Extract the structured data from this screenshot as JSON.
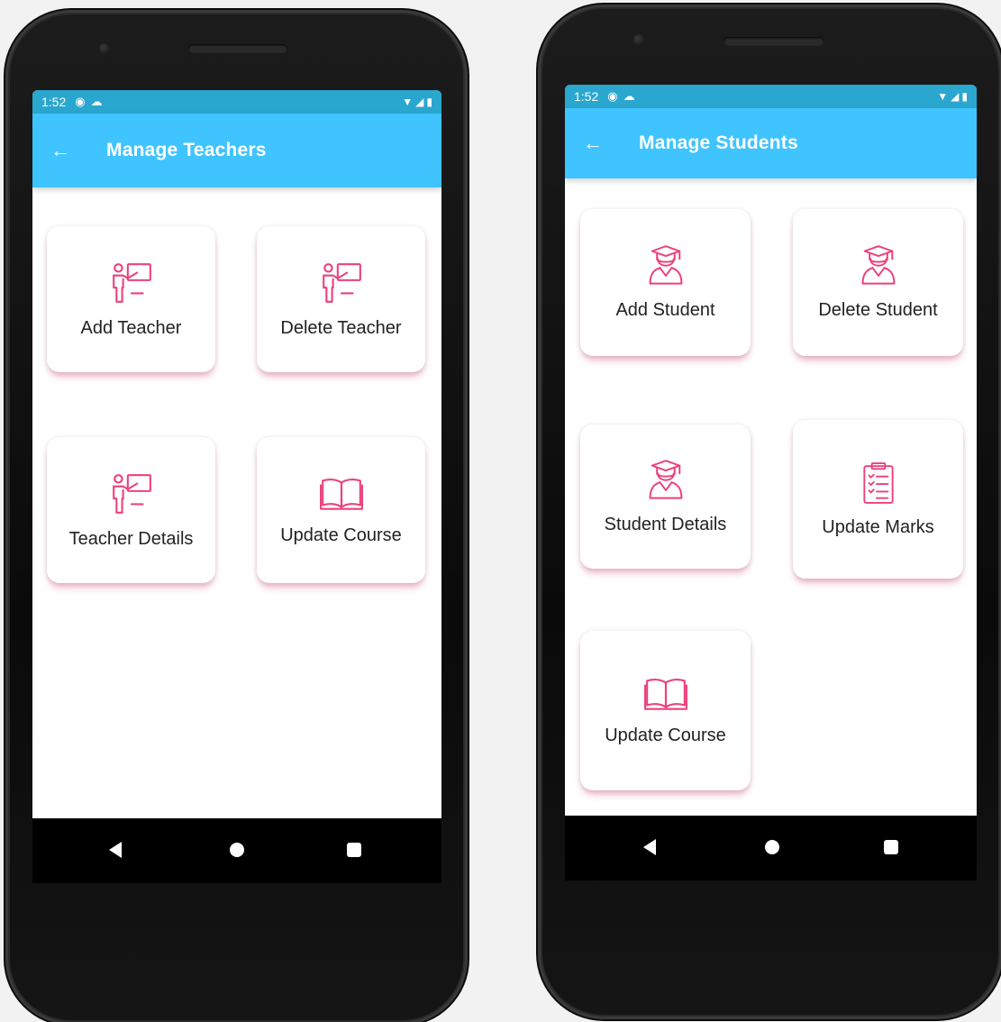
{
  "theme": {
    "statusbar_color": "#2aa7cf",
    "appbar_color": "#40c4ff",
    "icon_color": "#ec407a"
  },
  "teachers_screen": {
    "status_time": "1:52",
    "title": "Manage Teachers",
    "cards": [
      {
        "label": "Add Teacher",
        "icon": "teacher-board-icon"
      },
      {
        "label": "Delete Teacher",
        "icon": "teacher-board-icon"
      },
      {
        "label": "Teacher Details",
        "icon": "teacher-board-icon"
      },
      {
        "label": "Update Course",
        "icon": "book-icon"
      }
    ]
  },
  "students_screen": {
    "status_time": "1:52",
    "title": "Manage Students",
    "cards": [
      {
        "label": "Add Student",
        "icon": "graduate-icon"
      },
      {
        "label": "Delete Student",
        "icon": "graduate-icon"
      },
      {
        "label": "Student Details",
        "icon": "graduate-icon"
      },
      {
        "label": "Update Marks",
        "icon": "clipboard-icon"
      },
      {
        "label": "Update Course",
        "icon": "book-icon"
      }
    ]
  }
}
